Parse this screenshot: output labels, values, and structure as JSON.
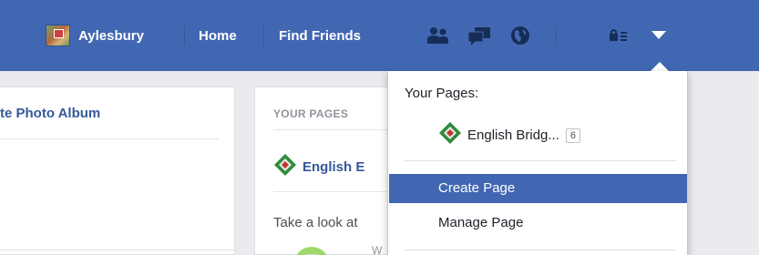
{
  "topbar": {
    "profile_name": "Aylesbury",
    "home_label": "Home",
    "find_friends_label": "Find Friends",
    "icons": [
      "friend-requests-icon",
      "messages-icon",
      "notifications-globe-icon",
      "privacy-lock-icon",
      "account-menu-chevron-icon"
    ],
    "bar_color": "#4267b2"
  },
  "left_card": {
    "link_text": "te Photo Album"
  },
  "middle_card": {
    "section_title": "YOUR PAGES",
    "page_name": "English E",
    "footer_text": "Take a look at",
    "partial_text": "W"
  },
  "dropdown": {
    "header": "Your Pages:",
    "page_name": "English Bridg...",
    "page_badge": "6",
    "items": [
      {
        "label": "Create Page",
        "active": true
      },
      {
        "label": "Manage Page",
        "active": false
      }
    ],
    "highlight_color": "#4267b2"
  }
}
